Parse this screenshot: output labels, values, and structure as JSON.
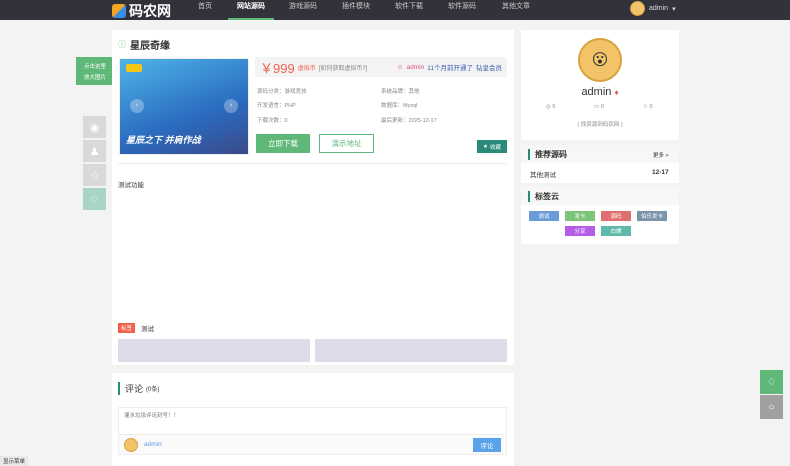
{
  "nav": {
    "logo": "码农网",
    "items": [
      "首页",
      "网站源码",
      "游戏源码",
      "插件模块",
      "软件下载",
      "软件源码",
      "其他文章"
    ],
    "active": 1,
    "user": "admin"
  },
  "detail": {
    "title": "星辰奇缘",
    "banner_text": "星辰之下 并肩作战",
    "price": "￥999",
    "currency": "虚拟币",
    "how_to": "[如何获取虚拟币?]",
    "author": "admin",
    "author_status": "11个月前开通了",
    "vip": "钻皇会员",
    "fields": [
      {
        "label": "源码分类：",
        "value": "游戏竞技"
      },
      {
        "label": "系统品牌：",
        "value": "其他"
      },
      {
        "label": "开发语言：",
        "value": "PHP"
      },
      {
        "label": "数据库：",
        "value": "Mysql"
      },
      {
        "label": "下载次数：",
        "value": "0"
      },
      {
        "label": "最后更新：",
        "value": "2025-12-17"
      }
    ],
    "download": "立即下载",
    "demo": "演示地址",
    "favorite": "收藏"
  },
  "zoom_tip": [
    "点击这里",
    "放大图片"
  ],
  "content": {
    "text": "测试功能",
    "tag_label": "标签",
    "tag": "测试"
  },
  "comments": {
    "title": "评论",
    "count": "(0条)",
    "placeholder": "灌水垃圾评论封号！！",
    "user": "admin",
    "submit": "评论"
  },
  "profile": {
    "name": "admin",
    "views": "5",
    "comments": "0",
    "likes": "0",
    "motto": "( 找资源到码农网 )"
  },
  "recommend": {
    "title": "推荐源码",
    "more": "更多 >",
    "items": [
      {
        "name": "其他测试",
        "date": "12-17"
      }
    ]
  },
  "tagcloud": {
    "title": "标签云",
    "tags": [
      {
        "name": "测试",
        "color": "#6a9bd8"
      },
      {
        "name": "发卡",
        "color": "#7cc576"
      },
      {
        "name": "源码",
        "color": "#e07070"
      },
      {
        "name": "伯乐发卡",
        "color": "#7b93a8"
      },
      {
        "name": "分享",
        "color": "#b45ee8"
      },
      {
        "name": "白嫖",
        "color": "#5fb8a8"
      }
    ]
  },
  "footer": {
    "menu": "显示菜单"
  }
}
